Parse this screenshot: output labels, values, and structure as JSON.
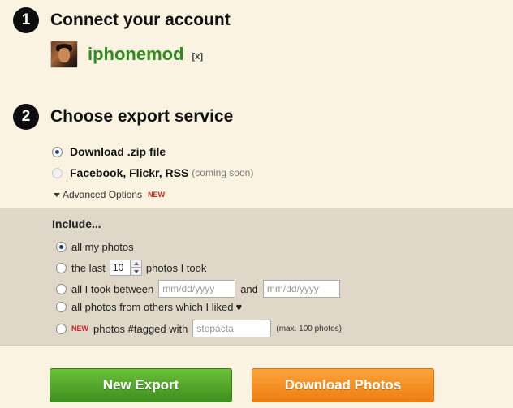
{
  "step1": {
    "number": "1",
    "title": "Connect your account"
  },
  "account": {
    "username": "iphonemod",
    "remove_label": "[x]"
  },
  "step2": {
    "number": "2",
    "title": "Choose export service"
  },
  "export_options": [
    {
      "label": "Download .zip file",
      "note": "",
      "checked": true
    },
    {
      "label": "Facebook, Flickr, RSS",
      "note": "(coming soon)",
      "checked": false
    }
  ],
  "advanced": {
    "label": "Advanced Options",
    "badge": "NEW"
  },
  "include": {
    "title": "Include...",
    "all_photos": "all my photos",
    "last_prefix": "the last",
    "last_count": "10",
    "last_suffix": "photos I took",
    "between_prefix": "all I took between",
    "date_placeholder": "mm/dd/yyyy",
    "between_and": "and",
    "liked": "all photos from others which I liked",
    "liked_heart": "♥",
    "tagged_badge": "NEW",
    "tagged_prefix": "photos #tagged with",
    "tag_placeholder": "stopacta",
    "tagged_note": "(max. 100 photos)"
  },
  "buttons": {
    "new_export": "New Export",
    "download": "Download Photos"
  },
  "colors": {
    "username": "#2e8b1e",
    "new_badge": "#d42020",
    "green_button": "#4fa426",
    "orange_button": "#f38d22"
  }
}
